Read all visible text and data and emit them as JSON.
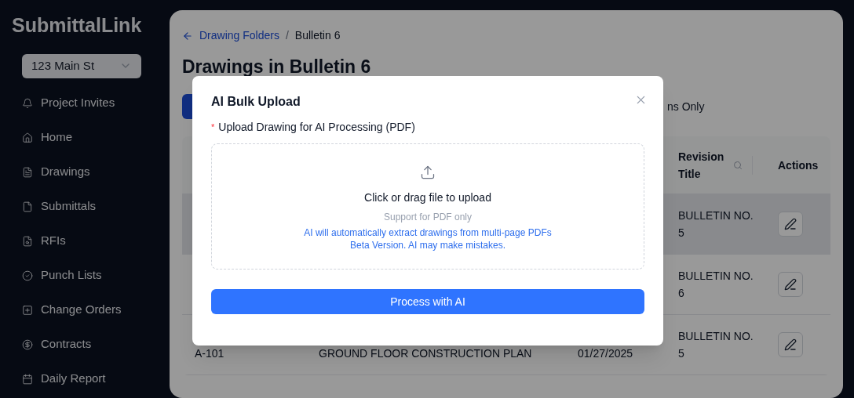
{
  "sidebar": {
    "logo": "SubmittalLink",
    "project_select": {
      "value": "123 Main St"
    },
    "items": [
      {
        "label": "Project Invites"
      },
      {
        "label": "Home"
      },
      {
        "label": "Drawings"
      },
      {
        "label": "Submittals"
      },
      {
        "label": "RFIs"
      },
      {
        "label": "Punch Lists"
      },
      {
        "label": "Change Orders"
      },
      {
        "label": "Contracts"
      },
      {
        "label": "Daily Report"
      }
    ]
  },
  "breadcrumb": {
    "link": "Drawing Folders",
    "separator": "/",
    "current": "Bulletin 6"
  },
  "heading": "Drawings in Bulletin 6",
  "toolbar": {
    "toggle_label": "ns Only"
  },
  "table": {
    "columns": [
      {
        "label": "Revision Title",
        "searchable": true
      },
      {
        "label": "Actions",
        "searchable": false
      }
    ],
    "rows": [
      {
        "revision_title": "BULLETIN NO. 5",
        "highlighted": true
      },
      {
        "revision_title": "BULLETIN NO. 6",
        "highlighted": false
      },
      {
        "number": "A-101",
        "title": "GROUND FLOOR CONSTRUCTION PLAN",
        "date": "01/27/2025",
        "revision_title": "BULLETIN NO. 5",
        "highlighted": false
      }
    ]
  },
  "modal": {
    "title": "AI Bulk Upload",
    "field_label": "Upload Drawing for AI Processing (PDF)",
    "required_mark": "*",
    "dropzone": {
      "text": "Click or drag file to upload",
      "hint": "Support for PDF only",
      "notes": [
        "AI will automatically extract drawings from multi-page PDFs",
        "Beta Version. AI may make mistakes."
      ]
    },
    "submit": "Process with AI"
  }
}
